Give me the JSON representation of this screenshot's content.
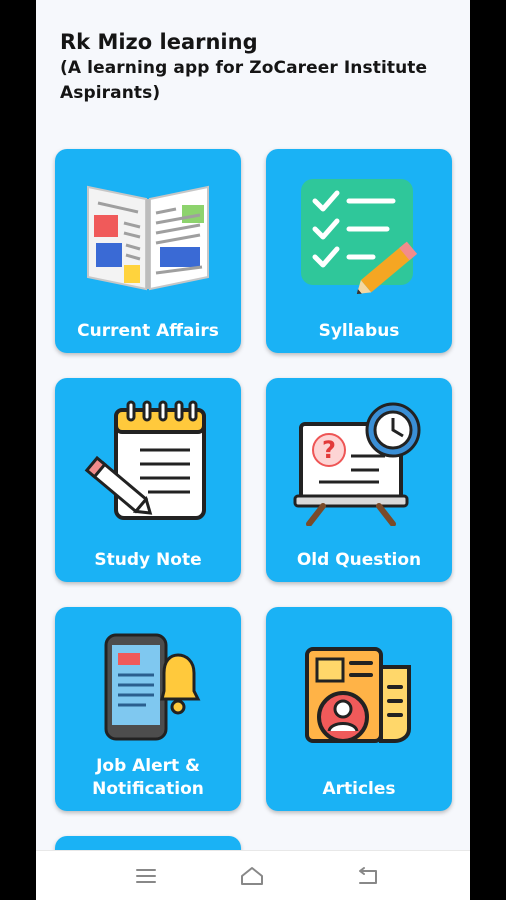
{
  "app": {
    "title": "Rk Mizo learning",
    "subtitle": "(A learning app for ZoCareer Institute Aspirants)"
  },
  "cards": [
    {
      "label": "Current Affairs",
      "icon": "newspaper-icon"
    },
    {
      "label": "Syllabus",
      "icon": "checklist-icon"
    },
    {
      "label": "Study Note",
      "icon": "notepad-icon"
    },
    {
      "label": "Old Question",
      "icon": "question-board-icon"
    },
    {
      "label": "Job Alert & Notification",
      "icon": "phone-bell-icon"
    },
    {
      "label": "Articles",
      "icon": "article-profile-icon"
    }
  ],
  "navbar": {
    "items": [
      "menu-icon",
      "home-icon",
      "back-icon"
    ]
  },
  "colors": {
    "card": "#1ab2f5",
    "background": "#f6f8fc",
    "text": "#151515"
  }
}
